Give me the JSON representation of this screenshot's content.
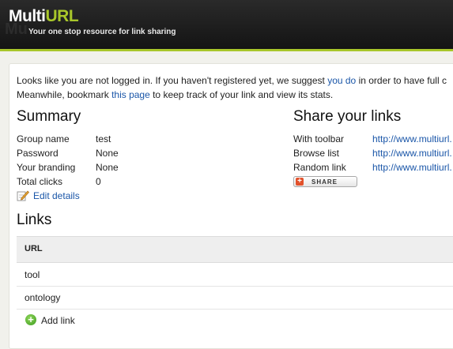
{
  "header": {
    "logo_part1": "Multi",
    "logo_part2": "URL",
    "tagline": "Your one stop resource for link sharing"
  },
  "intro": {
    "line1_pre": "Looks like you are not logged in. If you haven't registered yet, we suggest ",
    "line1_link": "you do",
    "line1_post": " in order to have full c",
    "line2_pre": "Meanwhile, bookmark ",
    "line2_link": "this page",
    "line2_post": " to keep track of your link and view its stats."
  },
  "summary": {
    "title": "Summary",
    "rows": [
      {
        "label": "Group name",
        "value": "test"
      },
      {
        "label": "Password",
        "value": "None"
      },
      {
        "label": "Your branding",
        "value": "None"
      },
      {
        "label": "Total clicks",
        "value": "0"
      }
    ],
    "edit_label": "Edit details"
  },
  "share": {
    "title": "Share your links",
    "rows": [
      {
        "label": "With toolbar",
        "value": "http://www.multiurl."
      },
      {
        "label": "Browse list",
        "value": "http://www.multiurl."
      },
      {
        "label": "Random link",
        "value": "http://www.multiurl."
      }
    ],
    "button_label": "SHARE"
  },
  "links": {
    "title": "Links",
    "column_header": "URL",
    "items": [
      "tool",
      "ontology"
    ],
    "add_label": "Add link"
  },
  "colors": {
    "accent": "#a8c62a",
    "link": "#1a56a8",
    "header_bg": "#1e1e1e"
  }
}
